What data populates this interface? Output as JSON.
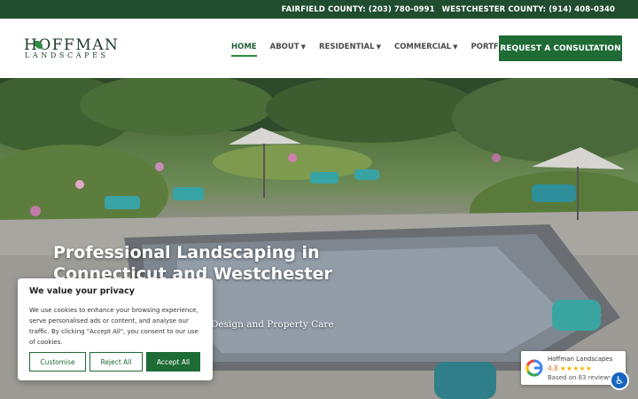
{
  "topbar": {
    "fairfield": "FAIRFIELD COUNTY: (203) 780-0991",
    "westchester": "WESTCHESTER COUNTY: (914) 408-0340"
  },
  "logo": {
    "word1": "HOFFMAN",
    "word2": "LANDSCAPES"
  },
  "nav": {
    "home": "HOME",
    "about": "ABOUT",
    "residential": "RESIDENTIAL",
    "commercial": "COMMERCIAL",
    "portfolio": "PORTFOLIO",
    "cta": "REQUEST A CONSULTATION"
  },
  "hero": {
    "title": "Professional Landscaping in Connecticut and Westchester for",
    "subtitle": "Design and Property Care"
  },
  "cookie": {
    "title": "We value your privacy",
    "body": "We use cookies to enhance your browsing experience, serve personalised ads or content, and analyse our traffic. By clicking \"Accept All\", you consent to our use of cookies.",
    "customise": "Customise",
    "reject": "Reject All",
    "accept": "Accept All"
  },
  "google_badge": {
    "name": "Hoffman Landscapes",
    "rating": "4.8",
    "stars": "★★★★★",
    "based_on": "Based on 83 reviews"
  },
  "colors": {
    "brand_green": "#1e6b36",
    "topbar": "#1f4d2e",
    "star": "#f4b400"
  },
  "icons": {
    "accessibility": "accessibility-icon",
    "google": "google-g-icon"
  }
}
